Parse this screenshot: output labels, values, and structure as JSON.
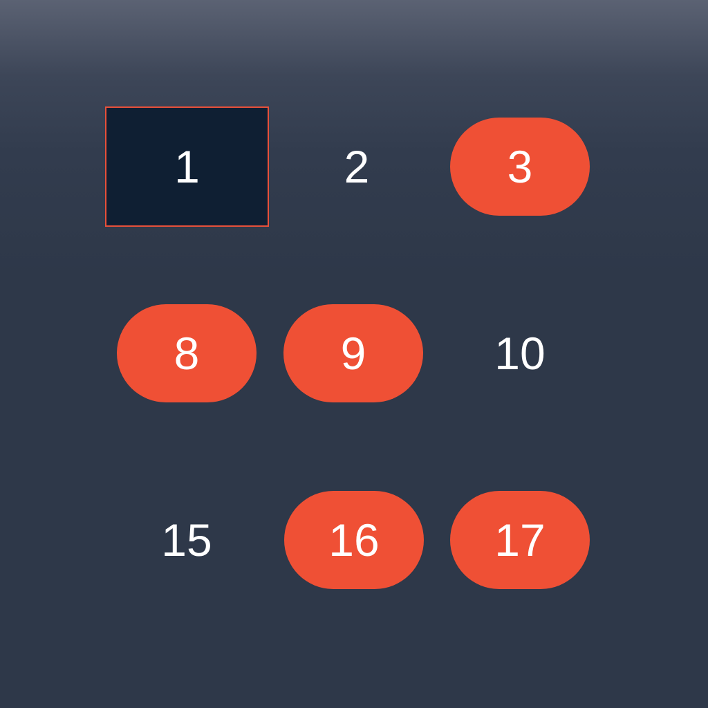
{
  "colors": {
    "background": "#2e3849",
    "background_top": "#5b6273",
    "highlight": "#ef5035",
    "selected_fill": "#0f1f33",
    "selected_border": "#e8503a",
    "text": "#ffffff"
  },
  "grid": {
    "cells": [
      {
        "label": "1",
        "state": "selected"
      },
      {
        "label": "2",
        "state": "plain"
      },
      {
        "label": "3",
        "state": "highlighted"
      },
      {
        "label": "8",
        "state": "highlighted"
      },
      {
        "label": "9",
        "state": "highlighted"
      },
      {
        "label": "10",
        "state": "plain"
      },
      {
        "label": "15",
        "state": "plain"
      },
      {
        "label": "16",
        "state": "highlighted"
      },
      {
        "label": "17",
        "state": "highlighted"
      }
    ]
  }
}
